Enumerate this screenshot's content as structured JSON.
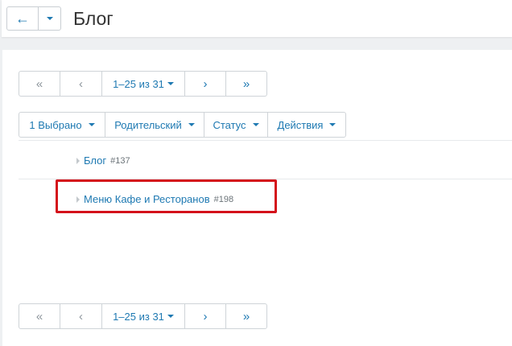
{
  "header": {
    "title": "Блог",
    "back_icon": "arrow-left-icon",
    "caret_icon": "caret-down-icon"
  },
  "pager": {
    "first": "«",
    "prev": "‹",
    "range": "1–25 из 31",
    "next": "›",
    "last": "»"
  },
  "filters": [
    {
      "label": "1 Выбрано"
    },
    {
      "label": "Родительский"
    },
    {
      "label": "Статус"
    },
    {
      "label": "Действия"
    }
  ],
  "items": [
    {
      "name": "Блог",
      "id": "#137"
    },
    {
      "name": "Меню Кафе и Ресторанов",
      "id": "#198",
      "highlighted": true
    }
  ],
  "colors": {
    "accent": "#1e79b2",
    "highlight": "#d4121b"
  }
}
